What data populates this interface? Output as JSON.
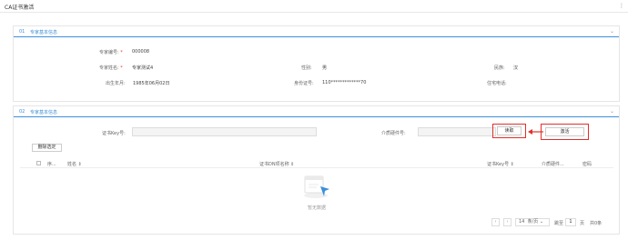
{
  "window": {
    "title": "CA证书激活",
    "more_icon": "⋮"
  },
  "section1": {
    "number": "01",
    "title": "专家基本信息",
    "fields": {
      "expert_id_label": "专家编号:",
      "expert_id_value": "000008",
      "expert_name_label": "专家姓名:",
      "expert_name_value": "专家测试4",
      "gender_label": "性别:",
      "gender_value": "男",
      "ethnicity_label": "民族:",
      "ethnicity_value": "汉",
      "birth_label": "出生年月:",
      "birth_value": "1985年06月02日",
      "idcard_label": "身份证号:",
      "idcard_value": "110*************70",
      "phone_label": "住宅电话:",
      "phone_value": ""
    }
  },
  "section2": {
    "number": "02",
    "title": "专家基本信息",
    "cert_key_label": "证书Key号:",
    "cert_key_value": "",
    "media_hw_label": "介质硬件号:",
    "media_hw_value": "",
    "read_button": "读取",
    "activate_button": "激活",
    "delete_button": "删除选定",
    "table": {
      "columns": [
        "序...",
        "姓名 ⇕",
        "证书DN项名称 ⇕",
        "证书Key号 ⇕",
        "介质硬件...",
        "密码"
      ],
      "empty_text": "暂无数据"
    },
    "pager": {
      "prev": "‹",
      "next": "›",
      "page_size": "14",
      "per_page": "条/页",
      "goto": "跳至",
      "page_value": "1",
      "page_unit": "页",
      "total": "共0条"
    }
  },
  "colors": {
    "accent": "#3d8fd9",
    "highlight": "#e0302a"
  }
}
